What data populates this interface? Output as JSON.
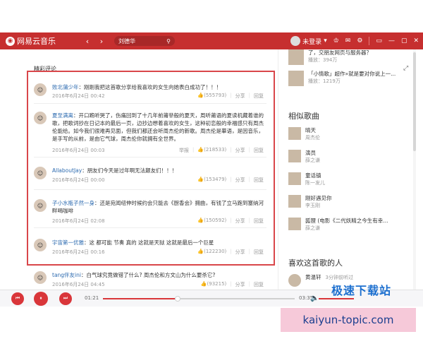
{
  "topbar": {
    "logo_text": "网易云音乐",
    "logo_mark": "◉",
    "back": "‹",
    "forward": "›",
    "search_value": "刘德华",
    "search_icon": "⚲",
    "login_text": "未登录",
    "icons": [
      "▾",
      "♔",
      "✉",
      "⚙",
      "▭",
      "—",
      "▢",
      "✕"
    ]
  },
  "section_title": "精彩评论",
  "comments": [
    {
      "user": "败北蒲少年",
      "text": "刚刚我把这首歌分享给我喜欢的女生向她表白成功了！！！",
      "time": "2016年6月24日 00:42",
      "likes": "(555793)",
      "share": "分享",
      "reply": "回复",
      "report": ""
    },
    {
      "user": "夏至满离",
      "text": "开口跪听哭了，伤痛回到了十几年前莆举般的夏天，周听莆语的夏读机藏着谁的歌，把歌词抄在日记本的最后一页，边抄边想着喜欢的女生，这种初恋般的幸福感只有周杰伦能给。如今我们很难再见面，但我们都还会听周杰伦的新歌。周杰伦是華语，是因音乐，是手写的从前，是由它气球，周杰伦你就拥有全世界。",
      "time": "2016年6月24日 00:03",
      "likes": "(218533)",
      "share": "分享",
      "reply": "回复",
      "report": "举报"
    },
    {
      "user": "AllaboutJay",
      "text": "朋友们今天是过年啊无法颠友们！！！",
      "time": "2016年6月24日 00:00",
      "likes": "(153479)",
      "share": "分享",
      "reply": "回复",
      "report": ""
    },
    {
      "user": "子小水瓶子然一身",
      "text": "还是宛闻纽伸时候约会只能去《厨香会》拥曲，有钱了立马跑到塞纳河畔喝咖啡",
      "time": "2016年6月24日 02:08",
      "likes": "(150592)",
      "share": "分享",
      "reply": "回复",
      "report": ""
    },
    {
      "user": "宇宙第一优雅",
      "text": "这 都可能 节奏 真的 这就是天狱 这就是最后一个巨星",
      "time": "2016年6月24日 00:16",
      "likes": "(122230)",
      "share": "分享",
      "reply": "回复",
      "report": ""
    },
    {
      "user": "tang伴友ini",
      "text": "白气球究竟做错了什么? 周杰伦和方文山为什么要杀它?",
      "time": "2016年6月24日 04:45",
      "likes": "(93215)",
      "share": "分享",
      "reply": "回复",
      "report": ""
    }
  ],
  "right_panel": {
    "top_items": [
      {
        "title": "了，交朋友网页与服务器？",
        "sub": "播放：394万"
      },
      {
        "title": "「小情歌」超作»就是要对你说上一...",
        "sub": "播放：1219万"
      }
    ],
    "similar_heading": "相似歌曲",
    "similar_songs": [
      {
        "title": "晴天",
        "artist": "周杰伦"
      },
      {
        "title": "演员",
        "artist": "薛之谦"
      },
      {
        "title": "童话镇",
        "artist": "陈一发儿"
      },
      {
        "title": "刚好遇见你",
        "artist": "李玉刚"
      },
      {
        "title": "狐狸 (电影《二代妖精之今生有幸...",
        "artist": "薛之谦"
      }
    ],
    "likers_heading": "喜欢这首歌的人",
    "likers": [
      {
        "name": "黄温轩",
        "sub": "3分钟前听过"
      }
    ]
  },
  "player": {
    "prev": "⏮",
    "play": "⏸",
    "next": "⏭",
    "current_time": "01:21",
    "total_time": "03:35",
    "progress": 0.39,
    "volume_icon": "🔈"
  },
  "watermark": "极速下载站",
  "url_text": "kaiyun-topic.com"
}
